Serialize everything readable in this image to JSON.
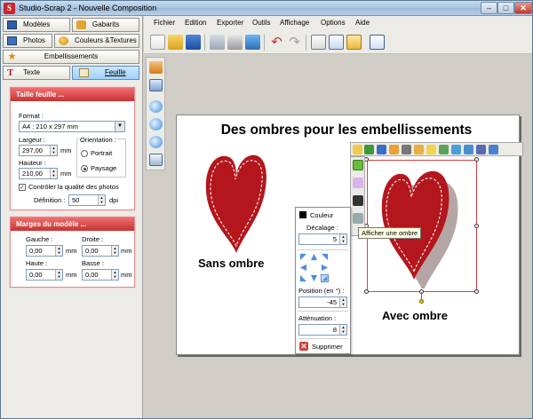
{
  "window": {
    "title": "Studio-Scrap 2 - Nouvelle Composition",
    "app_icon": "S"
  },
  "left_tabs": {
    "modeles": "Modèles",
    "gabarits": "Gabarits",
    "photos": "Photos",
    "couleurs": "Couleurs &Textures",
    "embellissements": "Embellissements",
    "texte": "Texte",
    "feuille": "Feuille"
  },
  "taille": {
    "header": "Taille feuille ...",
    "format_label": "Format :",
    "format_value": "A4 : 210 x 297 mm",
    "largeur_label": "Largeur :",
    "largeur_value": "297,00",
    "hauteur_label": "Hauteur :",
    "hauteur_value": "210,00",
    "unit": "mm",
    "orientation_label": "Orientation :",
    "portrait": "Portrait",
    "paysage": "Paysage",
    "controler": "Contrôler la qualité des photos",
    "definition_label": "Définition :",
    "definition_value": "50",
    "dpi": "dpi"
  },
  "marges": {
    "header": "Marges du modèle ...",
    "gauche_label": "Gauche :",
    "gauche_value": "0,00",
    "droite_label": "Droite :",
    "droite_value": "0,00",
    "haute_label": "Haute :",
    "haute_value": "0,00",
    "basse_label": "Basse :",
    "basse_value": "0,00",
    "unit": "mm"
  },
  "menus": [
    "Fichier",
    "Edition",
    "Exporter",
    "Outils",
    "Affichage",
    "Options",
    "Aide"
  ],
  "page": {
    "title": "Des ombres pour les embellissements",
    "label_left": "Sans ombre",
    "label_right": "Avec ombre"
  },
  "shadow_panel": {
    "couleur": "Couleur",
    "decalage_label": "Décalage :",
    "decalage_value": "5",
    "position_label": "Position (en °) :",
    "position_value": "-45",
    "attenuation_label": "Atténuation :",
    "attenuation_value": "8",
    "supprimer": "Supprimer"
  },
  "tooltip": "Afficher une ombre",
  "colors": {
    "heart": "#b3161c",
    "accent_red": "#d13b3b",
    "active_tab": "#9fd2ff"
  }
}
